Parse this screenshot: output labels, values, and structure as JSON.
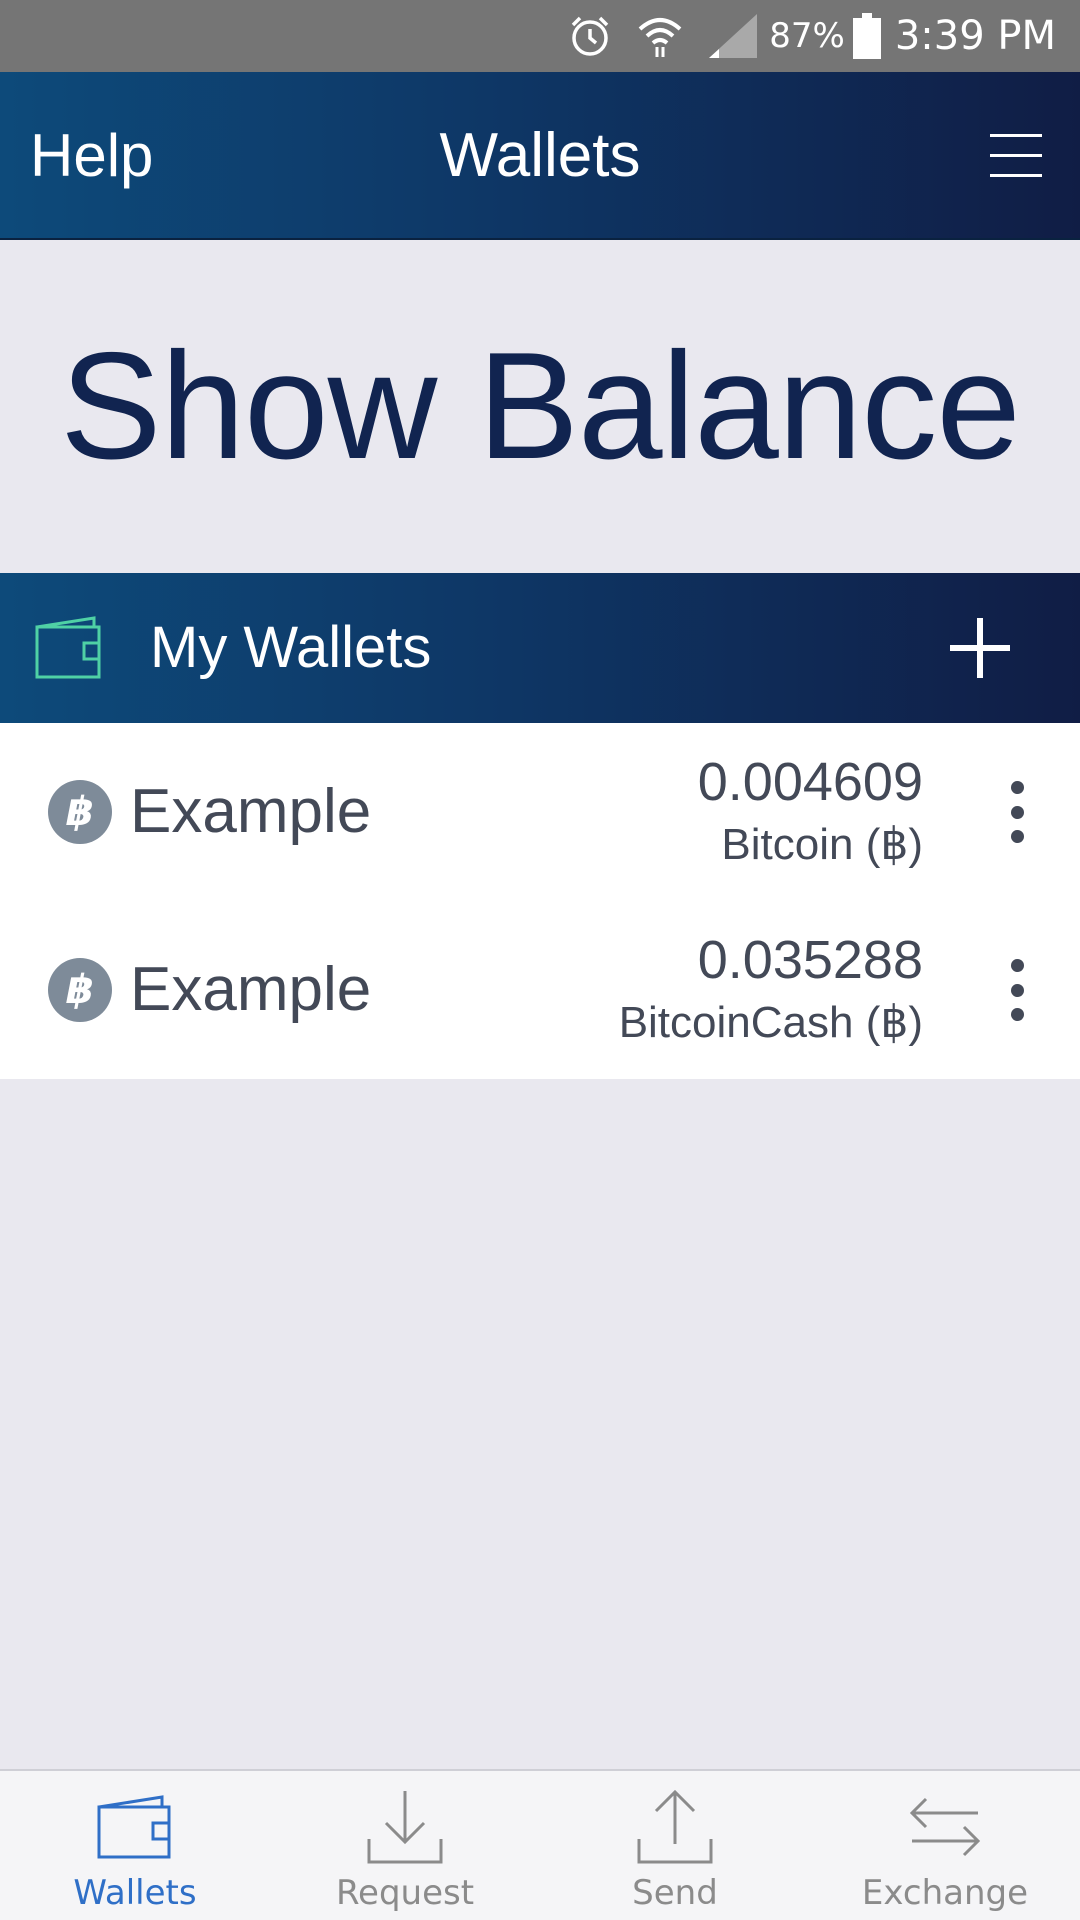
{
  "status_bar": {
    "battery": "87%",
    "time": "3:39 PM",
    "icons": [
      "alarm-icon",
      "wifi-icon",
      "signal-icon",
      "battery-icon"
    ]
  },
  "header": {
    "help_label": "Help",
    "title": "Wallets",
    "menu_icon": "hamburger-menu-icon"
  },
  "balance": {
    "label": "Show Balance"
  },
  "wallets_section": {
    "title": "My Wallets",
    "icon": "wallet-icon",
    "add_icon": "plus-icon"
  },
  "wallets": [
    {
      "name": "Example",
      "coin_symbol": "฿",
      "amount": "0.004609",
      "currency": "Bitcoin (฿)"
    },
    {
      "name": "Example",
      "coin_symbol": "฿",
      "amount": "0.035288",
      "currency": "BitcoinCash (฿)"
    }
  ],
  "bottom_nav": {
    "tabs": [
      {
        "label": "Wallets",
        "icon": "wallet-icon",
        "active": true
      },
      {
        "label": "Request",
        "icon": "download-icon",
        "active": false
      },
      {
        "label": "Send",
        "icon": "upload-icon",
        "active": false
      },
      {
        "label": "Exchange",
        "icon": "exchange-arrows-icon",
        "active": false
      }
    ]
  },
  "colors": {
    "header_start": "#0d4a7a",
    "header_end": "#101d45",
    "background": "#e9e8ef",
    "balance_text": "#112450",
    "wallet_icon_accent": "#4fd1a5",
    "active_tab": "#2f6fc7",
    "inactive_tab": "#8b8b8b"
  }
}
